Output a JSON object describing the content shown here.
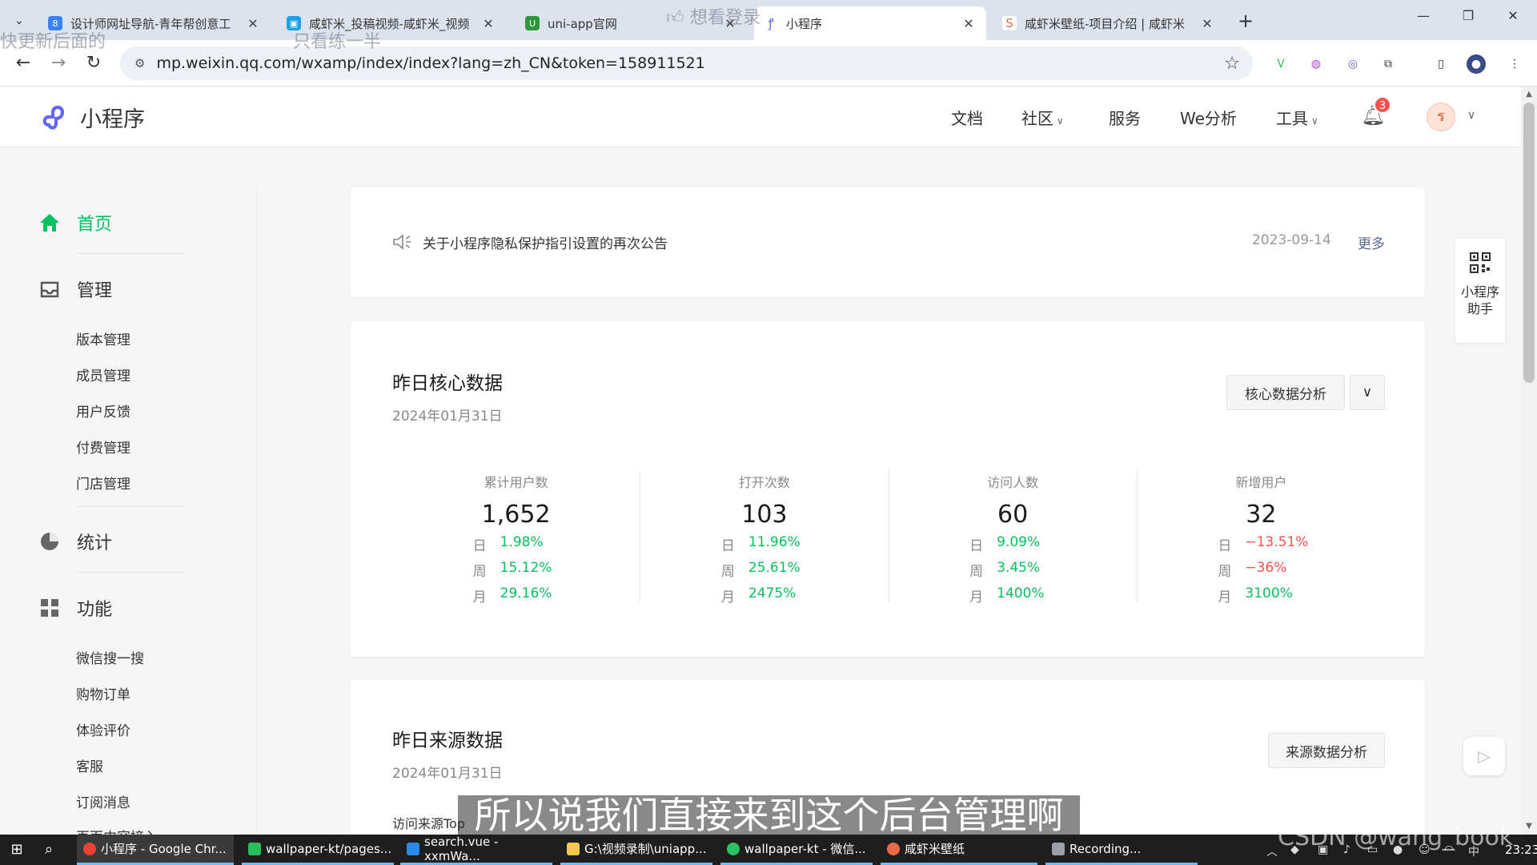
{
  "browser": {
    "tabs": [
      {
        "title": "设计师网址导航-青年帮创意工",
        "favicon": "8",
        "color": "#3b82f6"
      },
      {
        "title": "咸虾米_投稿视频-咸虾米_视频",
        "favicon": "bili-icon",
        "color": "#1ea0e6"
      },
      {
        "title": "uni-app官网",
        "favicon": "U",
        "color": "#2b9939"
      },
      {
        "title": "小程序",
        "favicon": "mp-icon",
        "color": "#6467f0"
      },
      {
        "title": "咸虾米壁纸-项目介绍 | 咸虾米",
        "favicon": "shrimp-icon",
        "color": "#e86a4a"
      }
    ],
    "url": "mp.weixin.qq.com/wxamp/index/index?lang=zh_CN&token=158911521"
  },
  "header": {
    "logo_text": "小程序",
    "nav": [
      {
        "label": "文档",
        "has_dropdown": false
      },
      {
        "label": "社区",
        "has_dropdown": true
      },
      {
        "label": "服务",
        "has_dropdown": false
      },
      {
        "label": "We分析",
        "has_dropdown": false
      },
      {
        "label": "工具",
        "has_dropdown": true
      }
    ],
    "notification_count": "3"
  },
  "sidebar": {
    "home": "首页",
    "manage": {
      "title": "管理",
      "items": [
        "版本管理",
        "成员管理",
        "用户反馈",
        "付费管理",
        "门店管理"
      ]
    },
    "stats": "统计",
    "features": {
      "title": "功能",
      "items": [
        "微信搜一搜",
        "购物订单",
        "体验评价",
        "客服",
        "订阅消息",
        "页面内容接入"
      ]
    }
  },
  "notice": {
    "text": "关于小程序隐私保护指引设置的再次公告",
    "date": "2023-09-14",
    "more": "更多"
  },
  "core": {
    "title": "昨日核心数据",
    "date": "2024年01月31日",
    "button": "核心数据分析",
    "period_labels": [
      "日",
      "周",
      "月"
    ],
    "metrics": [
      {
        "label": "累计用户数",
        "value": "1,652",
        "day": "1.98%",
        "week": "15.12%",
        "month": "29.16%",
        "day_dir": "up",
        "week_dir": "up",
        "month_dir": "up"
      },
      {
        "label": "打开次数",
        "value": "103",
        "day": "11.96%",
        "week": "25.61%",
        "month": "2475%",
        "day_dir": "up",
        "week_dir": "up",
        "month_dir": "up"
      },
      {
        "label": "访问人数",
        "value": "60",
        "day": "9.09%",
        "week": "3.45%",
        "month": "1400%",
        "day_dir": "up",
        "week_dir": "up",
        "month_dir": "up"
      },
      {
        "label": "新增用户",
        "value": "32",
        "day": "−13.51%",
        "week": "−36%",
        "month": "3100%",
        "day_dir": "down",
        "week_dir": "down",
        "month_dir": "up"
      }
    ]
  },
  "source": {
    "title": "昨日来源数据",
    "date": "2024年01月31日",
    "button": "来源数据分析",
    "label": "访问来源Top"
  },
  "assistant": {
    "line1": "小程序",
    "line2": "助手"
  },
  "overlays": {
    "top_left": "快更新后面的",
    "top_mid": "只看练一半",
    "top_like": "想看登录",
    "subtitle": "所以说我们直接来到这个后台管理啊",
    "watermark": "CSDN @wang_book"
  },
  "taskbar": {
    "apps": [
      {
        "label": "小程序 - Google Chr...",
        "color": "#e94235"
      },
      {
        "label": "wallpaper-kt/pages...",
        "color": "#2bbd5a"
      },
      {
        "label": "search.vue - xxmWa...",
        "color": "#2a8ae6"
      },
      {
        "label": "G:\\视频录制\\uniapp...",
        "color": "#f2c94c"
      },
      {
        "label": "wallpaper-kt - 微信...",
        "color": "#2cc162"
      },
      {
        "label": "咸虾米壁纸",
        "color": "#e86a4a"
      },
      {
        "label": "Recording...",
        "color": "#9aa0a6"
      }
    ],
    "time": "23:23"
  }
}
